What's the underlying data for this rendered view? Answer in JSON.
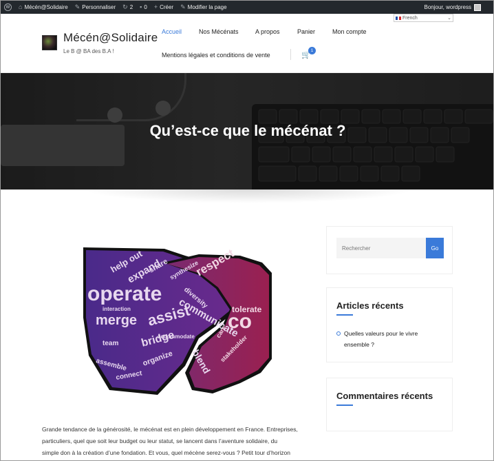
{
  "admin_bar": {
    "site_name": "Mécén@Solidaire",
    "customize": "Personnaliser",
    "updates_count": "2",
    "comments_count": "0",
    "new": "Créer",
    "edit_page": "Modifier la page",
    "greeting": "Bonjour, wordpress"
  },
  "language": {
    "selected": "French"
  },
  "header": {
    "site_title": "Mécén@Solidaire",
    "tagline": "Le B @ BA des B.A !"
  },
  "nav": {
    "items": [
      {
        "label": "Accueil",
        "active": true
      },
      {
        "label": "Nos Mécénats"
      },
      {
        "label": "A propos"
      },
      {
        "label": "Panier"
      },
      {
        "label": "Mon compte"
      },
      {
        "label": "Mentions légales et conditions de vente"
      }
    ],
    "cart_count": "1"
  },
  "hero": {
    "title": "Qu’est-ce que le mécénat ?"
  },
  "article": {
    "image_words": [
      "operate",
      "help out",
      "expand",
      "share",
      "merge",
      "assist",
      "bridge",
      "communicate",
      "respect",
      "tolerate",
      "diversity",
      "synthesize",
      "organize",
      "blend",
      "team",
      "interaction",
      "care",
      "accommodate",
      "assemble",
      "stakeholder",
      "connect",
      "co"
    ],
    "paragraph_lines": [
      "Grande tendance de la générosité, le mécénat est en plein développement en France. Entreprises,",
      "particuliers, quel que soit leur budget ou leur statut, se lancent dans l’aventure solidaire, du",
      "simple don à la création d’une fondation. Et vous, quel mécène serez-vous ? Petit tour d’horizon"
    ]
  },
  "sidebar": {
    "search": {
      "placeholder": "Rechercher",
      "button": "Go"
    },
    "recent_posts": {
      "title": "Articles récents",
      "items": [
        "Quelles valeurs pour le vivre ensemble ?"
      ]
    },
    "recent_comments": {
      "title": "Commentaires récents"
    }
  },
  "colors": {
    "accent": "#3a7ad9",
    "admin_bar": "#23282d",
    "hand_left": "#5b2a8c",
    "hand_right": "#8a2050"
  },
  "icons": [
    "wordpress-logo-icon",
    "home-icon",
    "brush-icon",
    "refresh-icon",
    "comment-icon",
    "plus-icon",
    "pencil-icon",
    "user-avatar-icon",
    "france-flag-icon",
    "chevron-down-icon",
    "cart-icon"
  ]
}
